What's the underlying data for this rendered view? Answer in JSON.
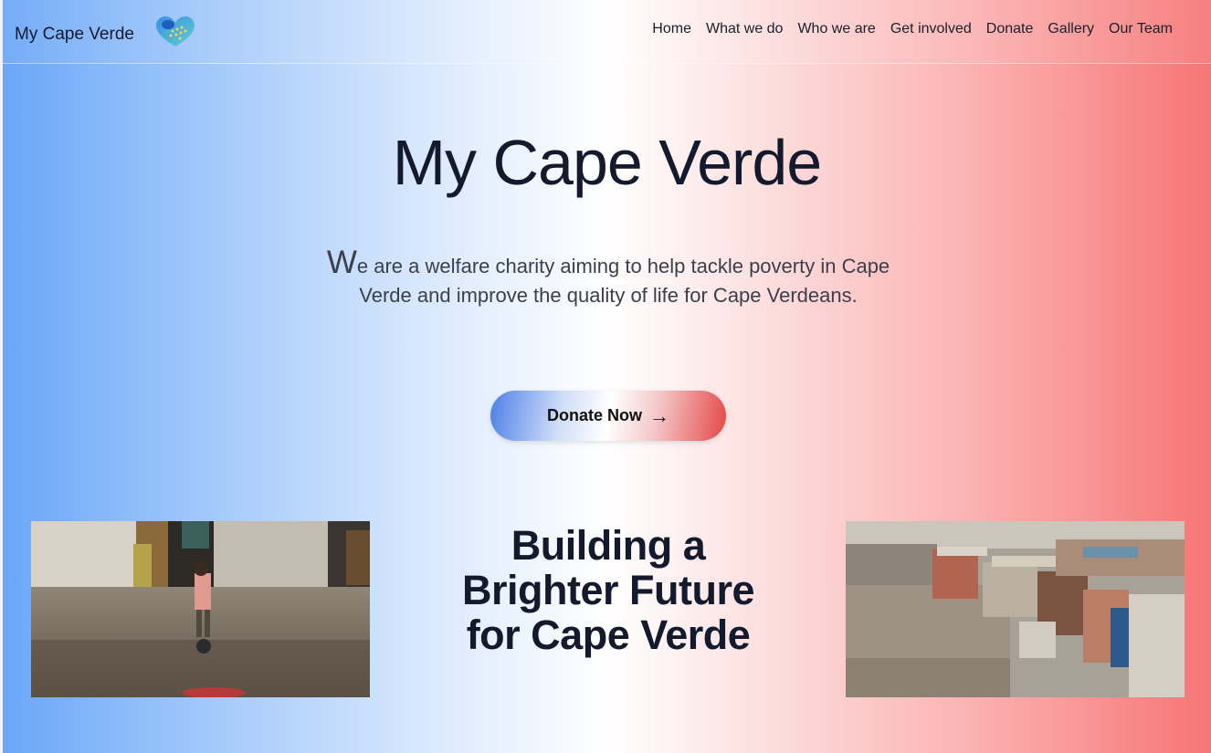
{
  "navbar": {
    "brand_name": "My Cape Verde",
    "logo_icon": "heart-globe-icon",
    "links": [
      "Home",
      "What we do",
      "Who we are",
      "Get involved",
      "Donate",
      "Gallery",
      "Our Team"
    ]
  },
  "hero": {
    "title": "My Cape Verde",
    "description_first_letter": "W",
    "description_rest": "e are a welfare charity aiming to help tackle poverty in Cape Verde and improve the quality of life for Cape Verdeans.",
    "cta_label": "Donate Now",
    "cta_icon": "arrow-right-icon"
  },
  "section": {
    "title": "Building a Brighter Future for Cape Verde"
  },
  "colors": {
    "blue_accent": "#6aa6f8",
    "red_accent": "#f77575",
    "text_dark": "#141a2e"
  }
}
